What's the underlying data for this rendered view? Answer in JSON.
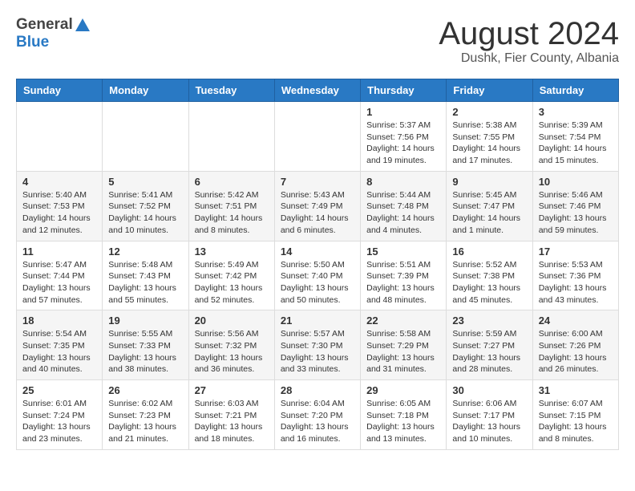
{
  "header": {
    "logo_general": "General",
    "logo_blue": "Blue",
    "month_title": "August 2024",
    "location": "Dushk, Fier County, Albania"
  },
  "calendar": {
    "days_of_week": [
      "Sunday",
      "Monday",
      "Tuesday",
      "Wednesday",
      "Thursday",
      "Friday",
      "Saturday"
    ],
    "weeks": [
      [
        {
          "day": "",
          "info": ""
        },
        {
          "day": "",
          "info": ""
        },
        {
          "day": "",
          "info": ""
        },
        {
          "day": "",
          "info": ""
        },
        {
          "day": "1",
          "info": "Sunrise: 5:37 AM\nSunset: 7:56 PM\nDaylight: 14 hours\nand 19 minutes."
        },
        {
          "day": "2",
          "info": "Sunrise: 5:38 AM\nSunset: 7:55 PM\nDaylight: 14 hours\nand 17 minutes."
        },
        {
          "day": "3",
          "info": "Sunrise: 5:39 AM\nSunset: 7:54 PM\nDaylight: 14 hours\nand 15 minutes."
        }
      ],
      [
        {
          "day": "4",
          "info": "Sunrise: 5:40 AM\nSunset: 7:53 PM\nDaylight: 14 hours\nand 12 minutes."
        },
        {
          "day": "5",
          "info": "Sunrise: 5:41 AM\nSunset: 7:52 PM\nDaylight: 14 hours\nand 10 minutes."
        },
        {
          "day": "6",
          "info": "Sunrise: 5:42 AM\nSunset: 7:51 PM\nDaylight: 14 hours\nand 8 minutes."
        },
        {
          "day": "7",
          "info": "Sunrise: 5:43 AM\nSunset: 7:49 PM\nDaylight: 14 hours\nand 6 minutes."
        },
        {
          "day": "8",
          "info": "Sunrise: 5:44 AM\nSunset: 7:48 PM\nDaylight: 14 hours\nand 4 minutes."
        },
        {
          "day": "9",
          "info": "Sunrise: 5:45 AM\nSunset: 7:47 PM\nDaylight: 14 hours\nand 1 minute."
        },
        {
          "day": "10",
          "info": "Sunrise: 5:46 AM\nSunset: 7:46 PM\nDaylight: 13 hours\nand 59 minutes."
        }
      ],
      [
        {
          "day": "11",
          "info": "Sunrise: 5:47 AM\nSunset: 7:44 PM\nDaylight: 13 hours\nand 57 minutes."
        },
        {
          "day": "12",
          "info": "Sunrise: 5:48 AM\nSunset: 7:43 PM\nDaylight: 13 hours\nand 55 minutes."
        },
        {
          "day": "13",
          "info": "Sunrise: 5:49 AM\nSunset: 7:42 PM\nDaylight: 13 hours\nand 52 minutes."
        },
        {
          "day": "14",
          "info": "Sunrise: 5:50 AM\nSunset: 7:40 PM\nDaylight: 13 hours\nand 50 minutes."
        },
        {
          "day": "15",
          "info": "Sunrise: 5:51 AM\nSunset: 7:39 PM\nDaylight: 13 hours\nand 48 minutes."
        },
        {
          "day": "16",
          "info": "Sunrise: 5:52 AM\nSunset: 7:38 PM\nDaylight: 13 hours\nand 45 minutes."
        },
        {
          "day": "17",
          "info": "Sunrise: 5:53 AM\nSunset: 7:36 PM\nDaylight: 13 hours\nand 43 minutes."
        }
      ],
      [
        {
          "day": "18",
          "info": "Sunrise: 5:54 AM\nSunset: 7:35 PM\nDaylight: 13 hours\nand 40 minutes."
        },
        {
          "day": "19",
          "info": "Sunrise: 5:55 AM\nSunset: 7:33 PM\nDaylight: 13 hours\nand 38 minutes."
        },
        {
          "day": "20",
          "info": "Sunrise: 5:56 AM\nSunset: 7:32 PM\nDaylight: 13 hours\nand 36 minutes."
        },
        {
          "day": "21",
          "info": "Sunrise: 5:57 AM\nSunset: 7:30 PM\nDaylight: 13 hours\nand 33 minutes."
        },
        {
          "day": "22",
          "info": "Sunrise: 5:58 AM\nSunset: 7:29 PM\nDaylight: 13 hours\nand 31 minutes."
        },
        {
          "day": "23",
          "info": "Sunrise: 5:59 AM\nSunset: 7:27 PM\nDaylight: 13 hours\nand 28 minutes."
        },
        {
          "day": "24",
          "info": "Sunrise: 6:00 AM\nSunset: 7:26 PM\nDaylight: 13 hours\nand 26 minutes."
        }
      ],
      [
        {
          "day": "25",
          "info": "Sunrise: 6:01 AM\nSunset: 7:24 PM\nDaylight: 13 hours\nand 23 minutes."
        },
        {
          "day": "26",
          "info": "Sunrise: 6:02 AM\nSunset: 7:23 PM\nDaylight: 13 hours\nand 21 minutes."
        },
        {
          "day": "27",
          "info": "Sunrise: 6:03 AM\nSunset: 7:21 PM\nDaylight: 13 hours\nand 18 minutes."
        },
        {
          "day": "28",
          "info": "Sunrise: 6:04 AM\nSunset: 7:20 PM\nDaylight: 13 hours\nand 16 minutes."
        },
        {
          "day": "29",
          "info": "Sunrise: 6:05 AM\nSunset: 7:18 PM\nDaylight: 13 hours\nand 13 minutes."
        },
        {
          "day": "30",
          "info": "Sunrise: 6:06 AM\nSunset: 7:17 PM\nDaylight: 13 hours\nand 10 minutes."
        },
        {
          "day": "31",
          "info": "Sunrise: 6:07 AM\nSunset: 7:15 PM\nDaylight: 13 hours\nand 8 minutes."
        }
      ]
    ]
  }
}
